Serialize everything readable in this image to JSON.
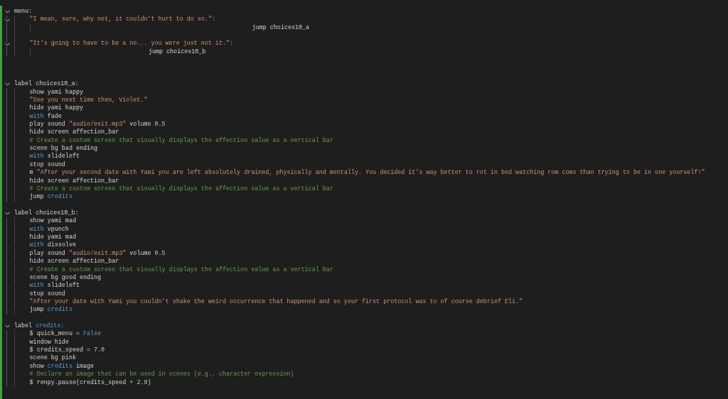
{
  "lines": [
    {
      "expanded": true,
      "tokens": [
        {
          "kind": "plain",
          "text": "menu:"
        }
      ],
      "children": [
        {
          "expanded": true,
          "tokens": [
            {
              "kind": "string",
              "text": "\"I mean, sure, why not, it couldn't hurt to do so.\":"
            }
          ],
          "children": [
            {
              "tokens": [
                {
                  "kind": "plain",
                  "text": "                                                          jump choices10_a"
                }
              ]
            }
          ]
        },
        {
          "kind": "blank"
        },
        {
          "expanded": true,
          "tokens": [
            {
              "kind": "string",
              "text": "\"It's going to have to be a no... you were just not it.\":"
            }
          ],
          "children": [
            {
              "tokens": [
                {
                  "kind": "plain",
                  "text": "                             jump choices10_b"
                }
              ]
            }
          ]
        }
      ]
    },
    {
      "kind": "blank"
    },
    {
      "kind": "blank"
    },
    {
      "kind": "blank"
    },
    {
      "expanded": true,
      "tokens": [
        {
          "kind": "plain",
          "text": "label choices10_a:"
        }
      ],
      "children": [
        {
          "tokens": [
            {
              "kind": "plain",
              "text": "show yami happy"
            }
          ]
        },
        {
          "tokens": [
            {
              "kind": "string",
              "text": "\"See you next time then, Violet.\""
            }
          ]
        },
        {
          "tokens": [
            {
              "kind": "plain",
              "text": "hide yami happy"
            }
          ]
        },
        {
          "tokens": [
            {
              "kind": "keyword",
              "text": "with"
            },
            {
              "kind": "plain",
              "text": " fade"
            }
          ]
        },
        {
          "tokens": [
            {
              "kind": "plain",
              "text": "play sound "
            },
            {
              "kind": "string",
              "text": "\"audio/exit.mp3\""
            },
            {
              "kind": "plain",
              "text": " volume "
            },
            {
              "kind": "number",
              "text": "0.5"
            }
          ]
        },
        {
          "tokens": [
            {
              "kind": "plain",
              "text": "hide screen affection_bar"
            }
          ]
        },
        {
          "tokens": [
            {
              "kind": "comment",
              "text": "# Create a custom screen that visually displays the affection value as a vertical bar"
            }
          ]
        },
        {
          "tokens": [
            {
              "kind": "plain",
              "text": "scene bg bad ending"
            }
          ]
        },
        {
          "tokens": [
            {
              "kind": "keyword",
              "text": "with"
            },
            {
              "kind": "plain",
              "text": " slideleft"
            }
          ]
        },
        {
          "tokens": [
            {
              "kind": "plain",
              "text": "stop sound"
            }
          ]
        },
        {
          "tokens": [
            {
              "kind": "plain",
              "text": "m "
            },
            {
              "kind": "string",
              "text": "\"After your second date with Yami you are left absolutely drained, physically and mentally. You decided it’s way better to rot in bed watching rom coms than trying to be in one yourself!\""
            }
          ]
        },
        {
          "tokens": [
            {
              "kind": "plain",
              "text": "hide screen affection_bar"
            }
          ]
        },
        {
          "tokens": [
            {
              "kind": "comment",
              "text": "# Create a custom screen that visually displays the affection value as a vertical bar"
            }
          ]
        },
        {
          "tokens": [
            {
              "kind": "plain",
              "text": "jump "
            },
            {
              "kind": "keyword",
              "text": "credits"
            }
          ]
        }
      ]
    },
    {
      "kind": "blank"
    },
    {
      "expanded": true,
      "tokens": [
        {
          "kind": "plain",
          "text": "label choices10_b:"
        }
      ],
      "children": [
        {
          "tokens": [
            {
              "kind": "plain",
              "text": "show yami mad"
            }
          ]
        },
        {
          "tokens": [
            {
              "kind": "keyword",
              "text": "with"
            },
            {
              "kind": "plain",
              "text": " vpunch"
            }
          ]
        },
        {
          "tokens": [
            {
              "kind": "plain",
              "text": "hide yami mad"
            }
          ]
        },
        {
          "tokens": [
            {
              "kind": "keyword",
              "text": "with"
            },
            {
              "kind": "plain",
              "text": " dissolve"
            }
          ]
        },
        {
          "tokens": [
            {
              "kind": "plain",
              "text": "play sound "
            },
            {
              "kind": "string",
              "text": "\"audio/exit.mp3\""
            },
            {
              "kind": "plain",
              "text": " volume "
            },
            {
              "kind": "number",
              "text": "0.5"
            }
          ]
        },
        {
          "tokens": [
            {
              "kind": "plain",
              "text": "hide screen affection_bar"
            }
          ]
        },
        {
          "tokens": [
            {
              "kind": "comment",
              "text": "# Create a custom screen that visually displays the affection value as a vertical bar"
            }
          ]
        },
        {
          "tokens": [
            {
              "kind": "plain",
              "text": "scene bg good ending"
            }
          ]
        },
        {
          "tokens": [
            {
              "kind": "keyword",
              "text": "with"
            },
            {
              "kind": "plain",
              "text": " slideleft"
            }
          ]
        },
        {
          "tokens": [
            {
              "kind": "plain",
              "text": "stop sound"
            }
          ]
        },
        {
          "tokens": [
            {
              "kind": "string",
              "text": "\"After your date with Yami you couldn’t shake the weird occurrence that happened and so your first protocol was to of course debrief Eli.\""
            }
          ]
        },
        {
          "tokens": [
            {
              "kind": "plain",
              "text": "jump "
            },
            {
              "kind": "keyword",
              "text": "credits"
            }
          ]
        }
      ]
    },
    {
      "kind": "blank"
    },
    {
      "expanded": true,
      "tokens": [
        {
          "kind": "plain",
          "text": "label "
        },
        {
          "kind": "keyword",
          "text": "credits:"
        }
      ],
      "children": [
        {
          "tokens": [
            {
              "kind": "plain",
              "text": "$ quick_menu = "
            },
            {
              "kind": "keyword",
              "text": "False"
            }
          ]
        },
        {
          "tokens": [
            {
              "kind": "plain",
              "text": "window hide"
            }
          ]
        },
        {
          "tokens": [
            {
              "kind": "plain",
              "text": "$ credits_speed = "
            },
            {
              "kind": "number",
              "text": "7.0"
            }
          ]
        },
        {
          "tokens": [
            {
              "kind": "plain",
              "text": "scene bg pink"
            }
          ]
        },
        {
          "tokens": [
            {
              "kind": "plain",
              "text": "show "
            },
            {
              "kind": "keyword",
              "text": "credits"
            },
            {
              "kind": "plain",
              "text": " image"
            }
          ]
        },
        {
          "tokens": [
            {
              "kind": "comment",
              "text": "# Declare an image that can be used in scenes (e.g., character expression)"
            }
          ]
        },
        {
          "tokens": [
            {
              "kind": "plain",
              "text": "$ renpy.pause(credits_speed + "
            },
            {
              "kind": "number",
              "text": "2.0"
            },
            {
              "kind": "plain",
              "text": ")"
            }
          ]
        }
      ]
    }
  ]
}
